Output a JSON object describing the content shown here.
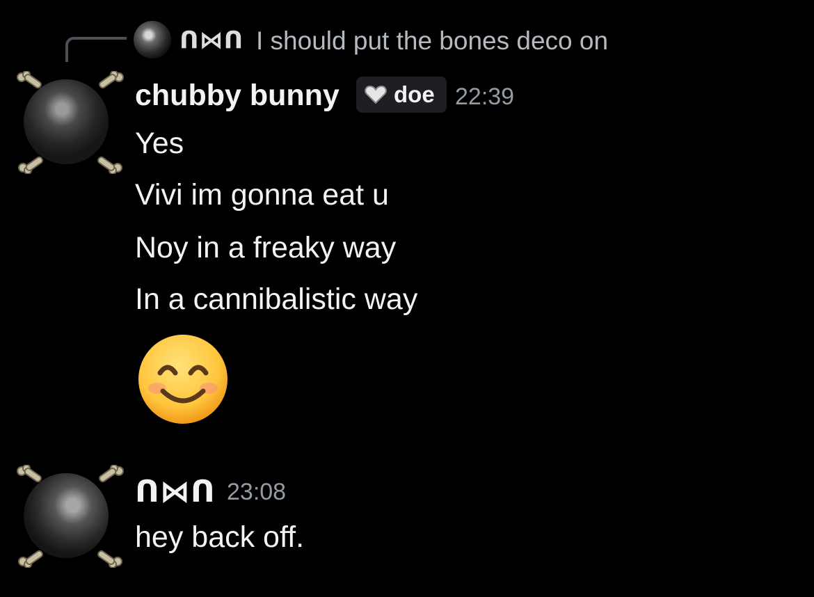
{
  "reply": {
    "author": "ᑎ⋈ᑎ",
    "text": "I should put the bones deco on"
  },
  "messages": [
    {
      "author": "chubby bunny",
      "tag_label": "doe",
      "time": "22:39",
      "lines": [
        "Yes",
        "Vivi im gonna eat u",
        "Noy in a freaky way",
        "In a cannibalistic way"
      ],
      "emoji_name": "smiling-face-with-smiling-eyes"
    },
    {
      "author": "ᑎ⋈ᑎ",
      "time": "23:08",
      "lines": [
        "hey back off."
      ]
    }
  ],
  "colors": {
    "background": "#000000",
    "primary_text": "#f2f3f5",
    "muted_text": "#b5bac1",
    "timestamp": "#949ba4",
    "tag_bg": "#1e1f22",
    "reply_spine": "#4e5058"
  }
}
